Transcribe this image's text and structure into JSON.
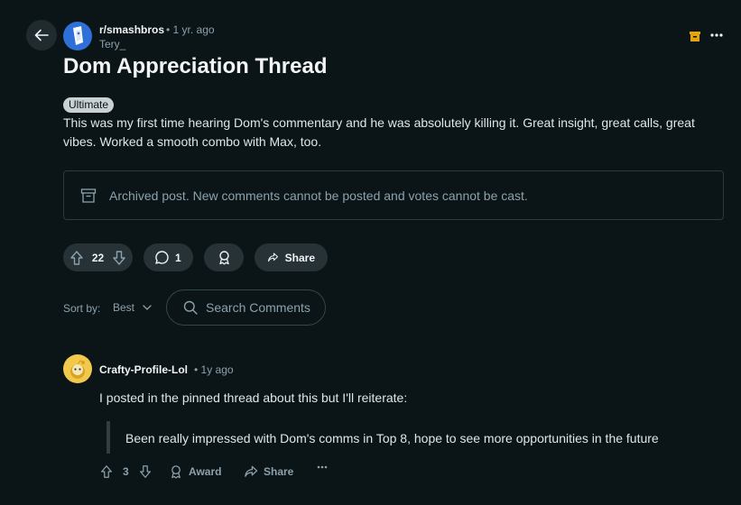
{
  "post": {
    "subreddit": "r/smashbros",
    "time": "• 1 yr. ago",
    "author": "Tery_",
    "title": "Dom Appreciation Thread",
    "flair": "Ultimate",
    "body": "This was my first time hearing Dom's commentary and he was absolutely killing it. Great insight, great calls, great vibes. Worked a smooth combo with Max, too.",
    "archived_notice": "Archived post. New comments cannot be posted and votes cannot be cast."
  },
  "actions": {
    "score": "22",
    "comments": "1",
    "share_label": "Share"
  },
  "sort": {
    "label": "Sort by:",
    "value": "Best"
  },
  "search": {
    "placeholder": "Search Comments"
  },
  "comment": {
    "author": "Crafty-Profile-Lol",
    "time": "• 1y ago",
    "text": "I posted in the pinned thread about this but I'll reiterate:",
    "quote": "Been really impressed with Dom's comms in Top 8, hope to see more opportunities in the future",
    "score": "3",
    "award_label": "Award",
    "share_label": "Share"
  },
  "colors": {
    "background": "#0b1416",
    "pill": "#263236",
    "subreddit_avatar": "#2f6fd8",
    "comment_avatar": "#f2c94c",
    "archive_icon": "#e5a50a"
  },
  "icons": [
    "back-arrow-icon",
    "archive-icon",
    "more-icon",
    "upvote-icon",
    "downvote-icon",
    "comment-icon",
    "award-icon",
    "share-icon",
    "chevron-down-icon",
    "search-icon"
  ]
}
